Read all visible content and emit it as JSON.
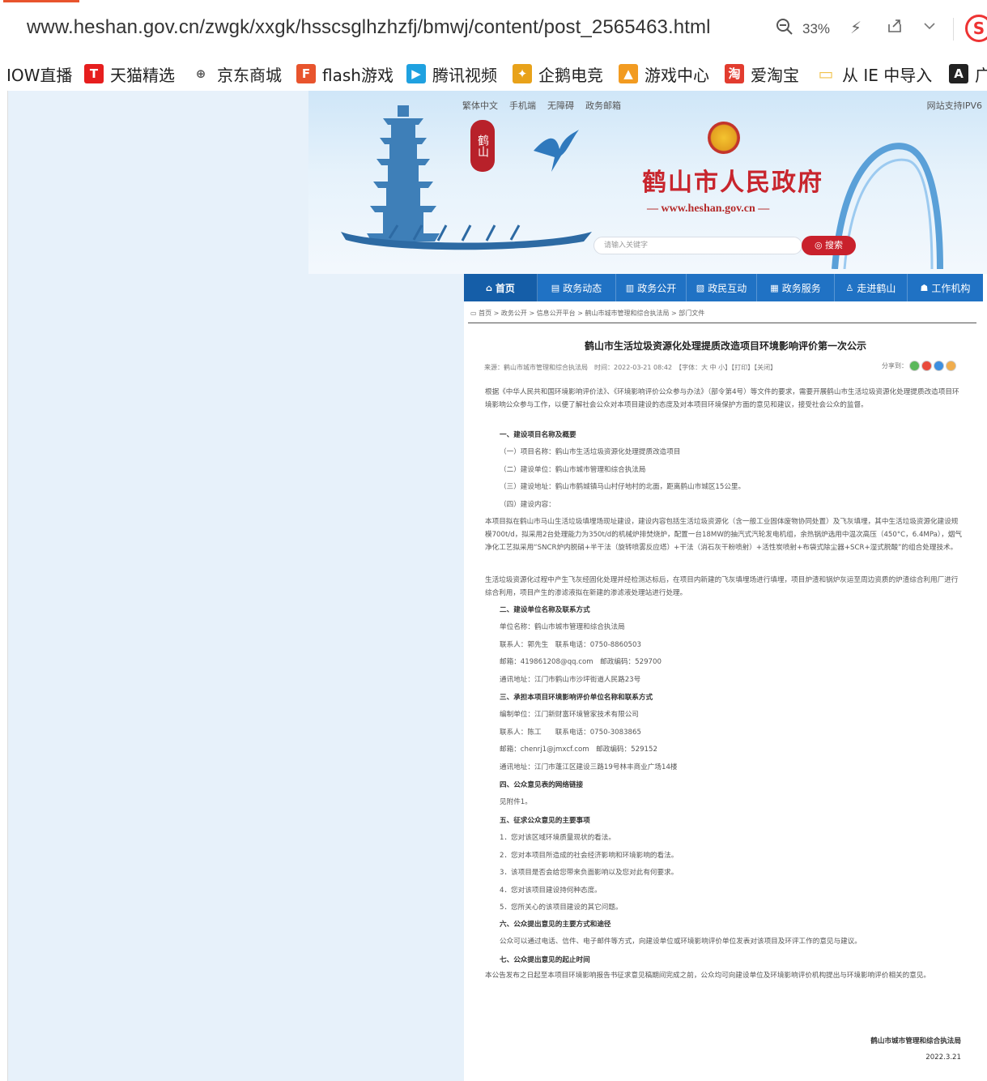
{
  "browser": {
    "url": "www.heshan.gov.cn/zwgk/xxgk/hsscsglhzhzfj/bmwj/content/post_2565463.html",
    "zoom": "33%",
    "icons": [
      "zoom-out-icon",
      "flash-icon",
      "share-icon",
      "chevron-down-icon",
      "extension-icon"
    ],
    "ext_letter": "S",
    "bookmarks": [
      {
        "label": "IOW直播",
        "icon": ""
      },
      {
        "label": "天猫精选",
        "icon": "T",
        "color": "#e61e1e"
      },
      {
        "label": "京东商城",
        "icon": "⊕",
        "color": "#555555"
      },
      {
        "label": "flash游戏",
        "icon": "F",
        "color": "#e8542d"
      },
      {
        "label": "腾讯视频",
        "icon": "▶",
        "color": "#1fa1e0"
      },
      {
        "label": "企鹅电竞",
        "icon": "✦",
        "color": "#e8a21a"
      },
      {
        "label": "游戏中心",
        "icon": "▲",
        "color": "#f29b21"
      },
      {
        "label": "爱淘宝",
        "icon": "淘",
        "color": "#e23c2f"
      },
      {
        "label": "从 IE 中导入",
        "icon": "▭",
        "color": "#f0c24b"
      },
      {
        "label": "广",
        "icon": "A",
        "color": "#222222"
      }
    ]
  },
  "banner": {
    "top_links": [
      "繁体中文",
      "手机端",
      "无障碍",
      "政务邮箱"
    ],
    "ipv6": "网站支持IPV6",
    "seal_text": "鹤山",
    "title": "鹤山市人民政府",
    "site_url": "— www.heshan.gov.cn —",
    "search_placeholder": "请输入关键字",
    "search_button": "◎ 搜索"
  },
  "nav": [
    {
      "label": "首页",
      "icon": "⌂"
    },
    {
      "label": "政务动态",
      "icon": "▤"
    },
    {
      "label": "政务公开",
      "icon": "▥"
    },
    {
      "label": "政民互动",
      "icon": "▧"
    },
    {
      "label": "政务服务",
      "icon": "▦"
    },
    {
      "label": "走进鹤山",
      "icon": "♙"
    },
    {
      "label": "工作机构",
      "icon": "☗"
    }
  ],
  "article": {
    "breadcrumb": "首页 > 政务公开 > 信息公开平台 > 鹤山市城市管理和综合执法局 > 部门文件",
    "title": "鹤山市生活垃圾资源化处理提质改造项目环境影响评价第一次公示",
    "meta": "来源：鹤山市城市管理和综合执法局　时间：2022-03-21 08:42　【字体：大 中 小】【打印】【关闭】",
    "share_label": "分享到：",
    "share_colors": [
      "#5cb85c",
      "#e94b3c",
      "#3d8fe0",
      "#f0ad4e"
    ],
    "intro": "根据《中华人民共和国环境影响评价法》、《环境影响评价公众参与办法》（部令第4号）等文件的要求，需要开展鹤山市生活垃圾资源化处理提质改造项目环境影响公众参与工作，以便了解社会公众对本项目建设的态度及对本项目环境保护方面的意见和建议，接受社会公众的监督。",
    "s1_title": "一、建设项目名称及概要",
    "s1_items": [
      "（一）项目名称：鹤山市生活垃圾资源化处理提质改造项目",
      "（二）建设单位：鹤山市城市管理和综合执法局",
      "（三）建设地址：鹤山市鹤城镇马山村仔地村的北面，距离鹤山市城区15公里。",
      "（四）建设内容："
    ],
    "s1_body1": "本项目拟在鹤山市马山生活垃圾填埋场现址建设，建设内容包括生活垃圾资源化（含一般工业固体废物协同处置）及飞灰填埋，其中生活垃圾资源化建设规模700t/d，拟采用2台处理能力为350t/d的机械炉排焚烧炉，配置一台18MW的抽汽式汽轮发电机组，余热锅炉选用中温次高压（450°C，6.4MPa），烟气净化工艺拟采用“SNCR炉内脱硝+半干法（旋转喷雾反应塔）+干法（消石灰干粉喷射）+活性炭喷射+布袋式除尘器+SCR+湿式脱酸”的组合处理技术。",
    "s1_body2": "生活垃圾资源化过程中产生飞灰经固化处理并经检测达标后，在项目内新建的飞灰填埋场进行填埋，项目炉渣和锅炉灰运至周边资质的炉渣综合利用厂进行综合利用，项目产生的渗滤液拟在新建的渗滤液处理站进行处理。",
    "s2_title": "二、建设单位名称及联系方式",
    "s2_items": [
      "单位名称：鹤山市城市管理和综合执法局",
      "联系人：郭先生　联系电话：0750-8860503",
      "邮箱：419861208@qq.com　邮政编码：529700",
      "通讯地址：江门市鹤山市沙坪街道人民路23号"
    ],
    "s3_title": "三、承担本项目环境影响评价单位名称和联系方式",
    "s3_items": [
      "编制单位：江门新财富环境管家技术有限公司",
      "联系人：陈工　　联系电话：0750-3083865",
      "邮箱：chenrj1@jmxcf.com　邮政编码：529152",
      "通讯地址：江门市蓬江区建设三路19号林丰商业广场14楼"
    ],
    "s4_title": "四、公众意见表的网络链接",
    "s4_items": [
      "见附件1。"
    ],
    "s5_title": "五、征求公众意见的主要事项",
    "s5_items": [
      "1．您对该区域环境质量现状的看法。",
      "2．您对本项目所造成的社会经济影响和环境影响的看法。",
      "3．该项目是否会给您带来负面影响以及您对此有何要求。",
      "4．您对该项目建设持何种态度。",
      "5．您所关心的该项目建设的其它问题。"
    ],
    "s6_title": "六、公众提出意见的主要方式和途径",
    "s6_items": [
      "公众可以通过电话、信件、电子邮件等方式，向建设单位或环境影响评价单位发表对该项目及环评工作的意见与建议。"
    ],
    "s7_title": "七、公众提出意见的起止时间",
    "s7_body": "本公告发布之日起至本项目环境影响报告书征求意见稿期间完成之前，公众均可向建设单位及环境影响评价机构提出与环境影响评价相关的意见。",
    "sign_org": "鹤山市城市管理和综合执法局",
    "sign_date": "2022.3.21"
  }
}
